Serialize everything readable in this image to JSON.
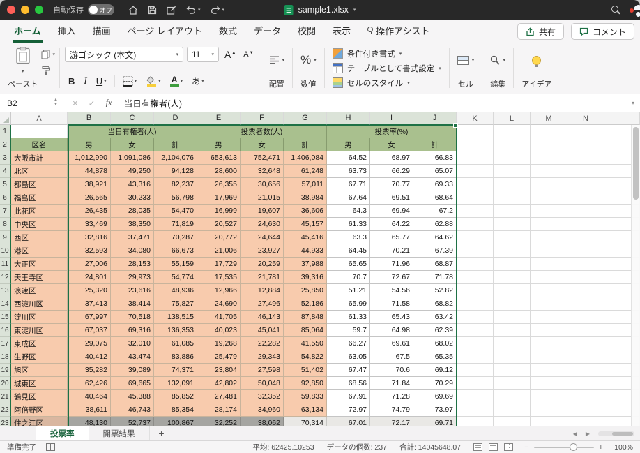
{
  "titlebar": {
    "autosave_label": "自動保存",
    "autosave_state": "オフ",
    "filename": "sample1.xlsx"
  },
  "ribbon": {
    "tabs": [
      {
        "label": "ホーム",
        "active": true
      },
      {
        "label": "挿入"
      },
      {
        "label": "描画"
      },
      {
        "label": "ページ レイアウト"
      },
      {
        "label": "数式"
      },
      {
        "label": "データ"
      },
      {
        "label": "校閲"
      },
      {
        "label": "表示"
      },
      {
        "label": "操作アシスト",
        "icon": "lightbulb"
      }
    ],
    "share_label": "共有",
    "comments_label": "コメント",
    "paste_label": "ペースト",
    "font_name": "游ゴシック (本文)",
    "font_size": "11",
    "bold_label": "B",
    "italic_label": "I",
    "underline_label": "U",
    "phonetic_label": "あ",
    "alignment_label": "配置",
    "number_label": "数値",
    "number_icon": "%",
    "cond_format_label": "条件付き書式",
    "table_format_label": "テーブルとして書式設定",
    "cell_styles_label": "セルのスタイル",
    "cells_label": "セル",
    "editing_label": "編集",
    "ideas_label": "アイデア"
  },
  "formula_bar": {
    "name_box": "B2",
    "fx_label": "fx",
    "formula": "当日有権者(人)"
  },
  "grid": {
    "column_letters": [
      "A",
      "B",
      "C",
      "D",
      "E",
      "F",
      "G",
      "H",
      "I",
      "J",
      "K",
      "L",
      "M",
      "N",
      ""
    ],
    "selected_columns": [
      "B",
      "C",
      "D",
      "E",
      "F",
      "G",
      "H",
      "I",
      "J"
    ],
    "row_numbers": [
      1,
      2,
      3,
      4,
      5,
      6,
      7,
      8,
      9,
      10,
      11,
      12,
      13,
      14,
      15,
      16,
      17,
      18,
      19,
      20,
      21,
      22,
      23
    ],
    "group_headers": [
      "当日有権者(人)",
      "投票者数(人)",
      "投票率(%)"
    ],
    "sub_headers": [
      "区名",
      "男",
      "女",
      "計",
      "男",
      "女",
      "計",
      "男",
      "女",
      "計"
    ],
    "rows": [
      {
        "name": "大阪市計",
        "values": [
          "1,012,990",
          "1,091,086",
          "2,104,076",
          "653,613",
          "752,471",
          "1,406,084",
          "64.52",
          "68.97",
          "66.83"
        ]
      },
      {
        "name": "北区",
        "values": [
          "44,878",
          "49,250",
          "94,128",
          "28,600",
          "32,648",
          "61,248",
          "63.73",
          "66.29",
          "65.07"
        ]
      },
      {
        "name": "都島区",
        "values": [
          "38,921",
          "43,316",
          "82,237",
          "26,355",
          "30,656",
          "57,011",
          "67.71",
          "70.77",
          "69.33"
        ]
      },
      {
        "name": "福島区",
        "values": [
          "26,565",
          "30,233",
          "56,798",
          "17,969",
          "21,015",
          "38,984",
          "67.64",
          "69.51",
          "68.64"
        ]
      },
      {
        "name": "此花区",
        "values": [
          "26,435",
          "28,035",
          "54,470",
          "16,999",
          "19,607",
          "36,606",
          "64.3",
          "69.94",
          "67.2"
        ]
      },
      {
        "name": "中央区",
        "values": [
          "33,469",
          "38,350",
          "71,819",
          "20,527",
          "24,630",
          "45,157",
          "61.33",
          "64.22",
          "62.88"
        ]
      },
      {
        "name": "西区",
        "values": [
          "32,816",
          "37,471",
          "70,287",
          "20,772",
          "24,644",
          "45,416",
          "63.3",
          "65.77",
          "64.62"
        ]
      },
      {
        "name": "港区",
        "values": [
          "32,593",
          "34,080",
          "66,673",
          "21,006",
          "23,927",
          "44,933",
          "64.45",
          "70.21",
          "67.39"
        ]
      },
      {
        "name": "大正区",
        "values": [
          "27,006",
          "28,153",
          "55,159",
          "17,729",
          "20,259",
          "37,988",
          "65.65",
          "71.96",
          "68.87"
        ]
      },
      {
        "name": "天王寺区",
        "values": [
          "24,801",
          "29,973",
          "54,774",
          "17,535",
          "21,781",
          "39,316",
          "70.7",
          "72.67",
          "71.78"
        ]
      },
      {
        "name": "浪速区",
        "values": [
          "25,320",
          "23,616",
          "48,936",
          "12,966",
          "12,884",
          "25,850",
          "51.21",
          "54.56",
          "52.82"
        ]
      },
      {
        "name": "西淀川区",
        "values": [
          "37,413",
          "38,414",
          "75,827",
          "24,690",
          "27,496",
          "52,186",
          "65.99",
          "71.58",
          "68.82"
        ]
      },
      {
        "name": "淀川区",
        "values": [
          "67,997",
          "70,518",
          "138,515",
          "41,705",
          "46,143",
          "87,848",
          "61.33",
          "65.43",
          "63.42"
        ]
      },
      {
        "name": "東淀川区",
        "values": [
          "67,037",
          "69,316",
          "136,353",
          "40,023",
          "45,041",
          "85,064",
          "59.7",
          "64.98",
          "62.39"
        ]
      },
      {
        "name": "東成区",
        "values": [
          "29,075",
          "32,010",
          "61,085",
          "19,268",
          "22,282",
          "41,550",
          "66.27",
          "69.61",
          "68.02"
        ]
      },
      {
        "name": "生野区",
        "values": [
          "40,412",
          "43,474",
          "83,886",
          "25,479",
          "29,343",
          "54,822",
          "63.05",
          "67.5",
          "65.35"
        ]
      },
      {
        "name": "旭区",
        "values": [
          "35,282",
          "39,089",
          "74,371",
          "23,804",
          "27,598",
          "51,402",
          "67.47",
          "70.6",
          "69.12"
        ]
      },
      {
        "name": "城東区",
        "values": [
          "62,426",
          "69,665",
          "132,091",
          "42,802",
          "50,048",
          "92,850",
          "68.56",
          "71.84",
          "70.29"
        ]
      },
      {
        "name": "鶴見区",
        "values": [
          "40,464",
          "45,388",
          "85,852",
          "27,481",
          "32,352",
          "59,833",
          "67.91",
          "71.28",
          "69.69"
        ]
      },
      {
        "name": "阿倍野区",
        "values": [
          "38,611",
          "46,743",
          "85,354",
          "28,174",
          "34,960",
          "63,134",
          "72.97",
          "74.79",
          "73.97"
        ]
      },
      {
        "name": "住之江区",
        "values": [
          "48,130",
          "52,737",
          "100,867",
          "32,252",
          "38,062",
          "70,314",
          "67.01",
          "72.17",
          "69.71"
        ]
      }
    ]
  },
  "sheet_tabs": {
    "tabs": [
      {
        "label": "投票率",
        "active": true
      },
      {
        "label": "開票結果",
        "active": false
      }
    ],
    "add_label": "+"
  },
  "status_bar": {
    "ready_label": "準備完了",
    "average_label": "平均:",
    "average_value": "62425.10253",
    "count_label": "データの個数:",
    "count_value": "237",
    "sum_label": "合計:",
    "sum_value": "14045648.07",
    "zoom_value": "100%"
  },
  "colors": {
    "excel_green": "#1e7145",
    "header_fill": "#a9c08e",
    "data_fill": "#f8cbad"
  }
}
